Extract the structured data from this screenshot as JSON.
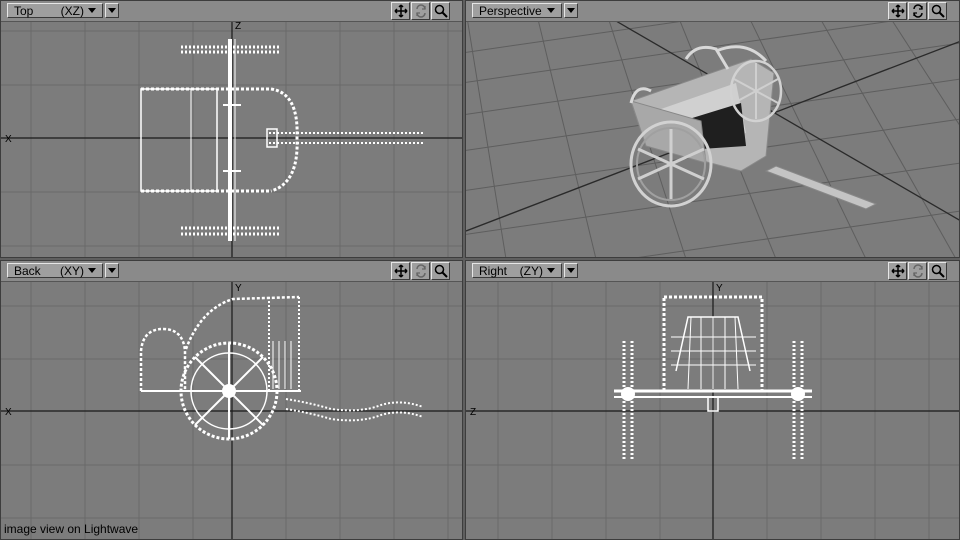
{
  "viewports": {
    "top": {
      "name": "Top",
      "axis": "(XZ)",
      "axis_labels": {
        "x": "X",
        "z": "Z"
      }
    },
    "perspective": {
      "name": "Perspective"
    },
    "back": {
      "name": "Back",
      "axis": "(XY)",
      "axis_labels": {
        "x": "X",
        "y": "Y"
      }
    },
    "right": {
      "name": "Right",
      "axis": "(ZY)",
      "axis_labels": {
        "z": "Z",
        "y": "Y"
      }
    }
  },
  "tools": {
    "move": "move-icon",
    "rotate": "rotate-icon",
    "zoom": "magnify-icon"
  },
  "caption": "image view on Lightwave",
  "colors": {
    "viewport_bg": "#7c7c7c",
    "grid": "#6a6a6a",
    "axis": "#1a1a1a",
    "wireframe": "#ffffff",
    "header": "#8a8a8a"
  }
}
